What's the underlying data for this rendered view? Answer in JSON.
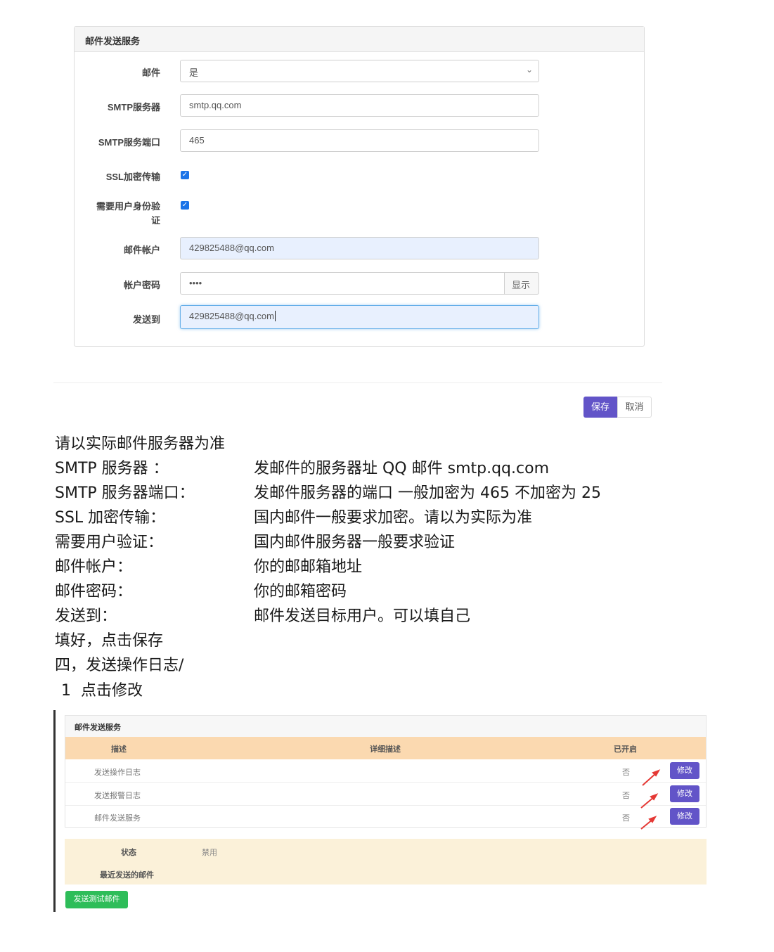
{
  "mail_form": {
    "title": "邮件发送服务",
    "fields": {
      "mail": {
        "label": "邮件",
        "value": "是"
      },
      "smtp_server": {
        "label": "SMTP服务器",
        "value": "smtp.qq.com"
      },
      "smtp_port": {
        "label": "SMTP服务端口",
        "value": "465"
      },
      "ssl": {
        "label": "SSL加密传输",
        "checked": true
      },
      "auth": {
        "label_line1": "需要用户身份验",
        "label_line2": "证",
        "checked": true
      },
      "account": {
        "label": "邮件帐户",
        "value": "429825488@qq.com"
      },
      "password": {
        "label": "帐户密码",
        "value": "••••",
        "toggle_label": "显示"
      },
      "send_to": {
        "label": "发送到",
        "value": "429825488@qq.com"
      }
    },
    "save_label": "保存",
    "cancel_label": "取消"
  },
  "notes": {
    "intro": "请以实际邮件服务器为准",
    "rows": [
      {
        "term": "SMTP  服务器  ：",
        "desc": "发邮件的服务器址  QQ 邮件  smtp.qq.com"
      },
      {
        "term": "SMTP  服务器端口：",
        "desc": "发邮件服务器的端口     一般加密为 465  不加密为 25"
      },
      {
        "term": "SSL 加密传输：",
        "desc": "国内邮件一般要求加密。请以为实际为准"
      },
      {
        "term": "需要用户验证：",
        "desc": "国内邮件服务器一般要求验证"
      },
      {
        "term": "邮件帐户：",
        "desc": "你的邮邮箱地址"
      },
      {
        "term": "邮件密码：",
        "desc": "你的邮箱密码"
      },
      {
        "term": "发送到：",
        "desc": "邮件发送目标用户。可以填自己"
      }
    ],
    "after_fill": "填好，点击保存",
    "section4": "四，发送操作日志/",
    "step1": " 1  点击修改"
  },
  "service_table": {
    "title": "邮件发送服务",
    "headers": [
      "描述",
      "详细描述",
      "已开启"
    ],
    "rows": [
      {
        "name": "发送操作日志",
        "enabled": "否",
        "action": "修改"
      },
      {
        "name": "发送报警日志",
        "enabled": "否",
        "action": "修改"
      },
      {
        "name": "邮件发送服务",
        "enabled": "否",
        "action": "修改"
      }
    ]
  },
  "status_panel": {
    "status_label": "状态",
    "status_value": "禁用",
    "recent_label": "最近发送的邮件",
    "test_button": "发送测试邮件"
  },
  "colors": {
    "primary": "#6254c8",
    "success": "#2ebd59",
    "table_header": "#fbd9b0",
    "status_bg": "#fbf1d9",
    "arrow": "#e53935"
  }
}
